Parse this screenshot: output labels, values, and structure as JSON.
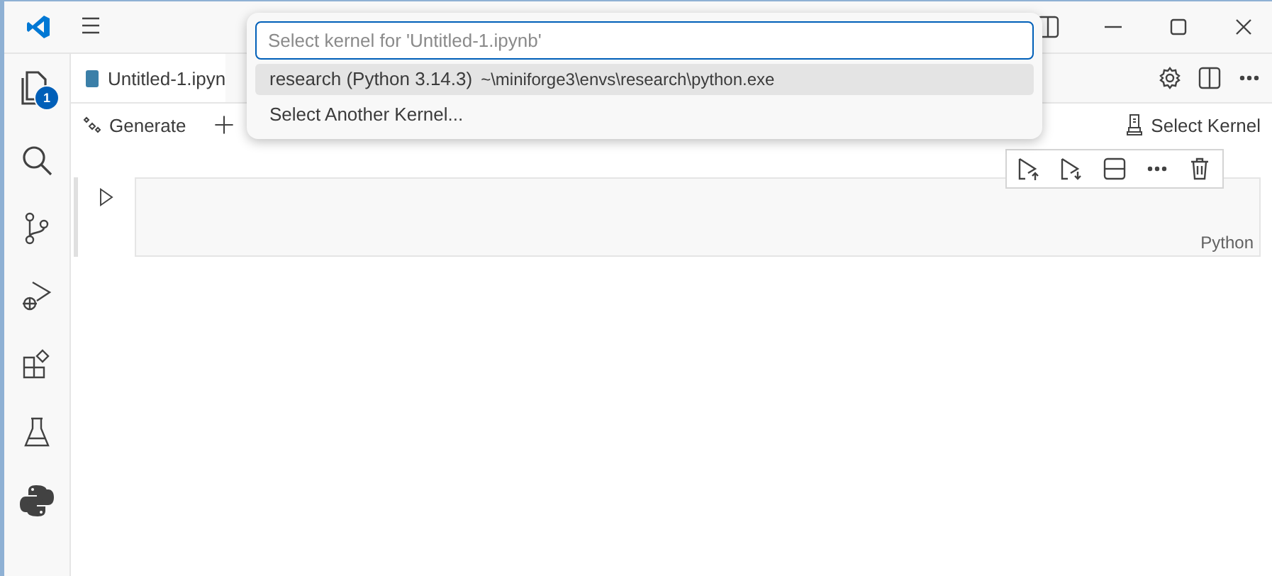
{
  "tab": {
    "label": "Untitled-1.ipyn"
  },
  "activity_bar": {
    "explorer_badge": "1"
  },
  "toolbar": {
    "generate": "Generate",
    "select_kernel": "Select Kernel"
  },
  "cell": {
    "language": "Python"
  },
  "kernel_picker": {
    "placeholder": "Select kernel for 'Untitled-1.ipynb'",
    "items": [
      {
        "label": "research (Python 3.14.3)",
        "detail": "~\\miniforge3\\envs\\research\\python.exe",
        "selected": true
      },
      {
        "label": "Select Another Kernel...",
        "selected": false
      }
    ]
  }
}
